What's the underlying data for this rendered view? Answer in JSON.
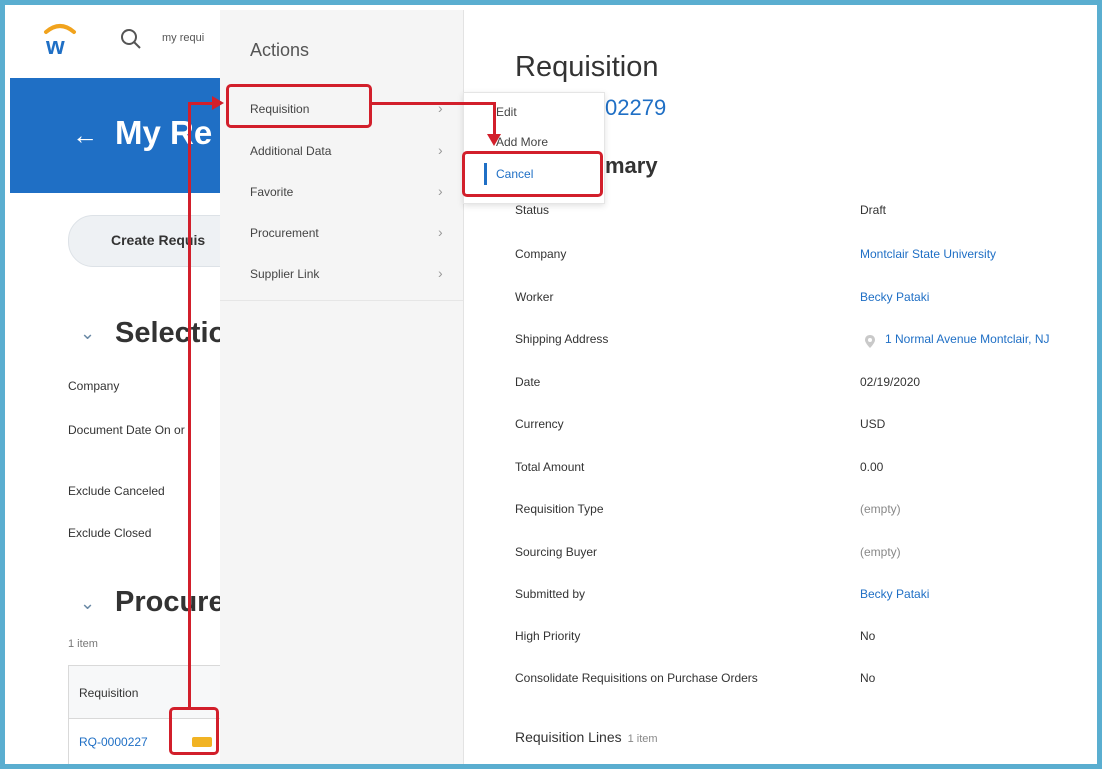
{
  "search": {
    "query": "my requi"
  },
  "left_page": {
    "back_arrow": "←",
    "header_title": "My Re",
    "create_button": "Create Requis",
    "selection_title": "Selectio",
    "fields": [
      "Company",
      "Document Date On or",
      "Exclude Canceled",
      "Exclude Closed"
    ],
    "procurement_title": "Procure",
    "item_count": "1 item",
    "table_header": "Requisition",
    "table_row_link": "RQ-0000227"
  },
  "actions": {
    "title": "Actions",
    "items": [
      {
        "label": "Requisition",
        "chevron": "›"
      },
      {
        "label": "Additional Data",
        "chevron": "›"
      },
      {
        "label": "Favorite",
        "chevron": "›"
      },
      {
        "label": "Procurement",
        "chevron": "›"
      },
      {
        "label": "Supplier Link",
        "chevron": "›"
      }
    ]
  },
  "submenu": {
    "items": [
      {
        "label": "Edit"
      },
      {
        "label": "Add More"
      },
      {
        "label": "Cancel"
      }
    ]
  },
  "requisition": {
    "title": "Requisition",
    "id": "02279",
    "summary_heading": "mary",
    "rows": [
      {
        "label": "Status",
        "value": "Draft"
      },
      {
        "label": "Company",
        "value": "Montclair State University"
      },
      {
        "label": "Worker",
        "value": "Becky Pataki"
      },
      {
        "label": "Shipping Address",
        "value": "1 Normal Avenue Montclair, NJ"
      },
      {
        "label": "Date",
        "value": "02/19/2020"
      },
      {
        "label": "Currency",
        "value": "USD"
      },
      {
        "label": "Total Amount",
        "value": "0.00"
      },
      {
        "label": "Requisition Type",
        "value": "(empty)"
      },
      {
        "label": "Sourcing Buyer",
        "value": "(empty)"
      },
      {
        "label": "Submitted by",
        "value": "Becky Pataki"
      },
      {
        "label": "High Priority",
        "value": "No"
      },
      {
        "label": "Consolidate Requisitions on Purchase Orders",
        "value": "No"
      }
    ],
    "lines_label": "Requisition Lines",
    "lines_count": "1 item"
  },
  "colors": {
    "brand_blue": "#1f6fc5",
    "annotation_red": "#d21f2b",
    "frame": "#5aaed0",
    "related_icon": "#f1b323"
  }
}
